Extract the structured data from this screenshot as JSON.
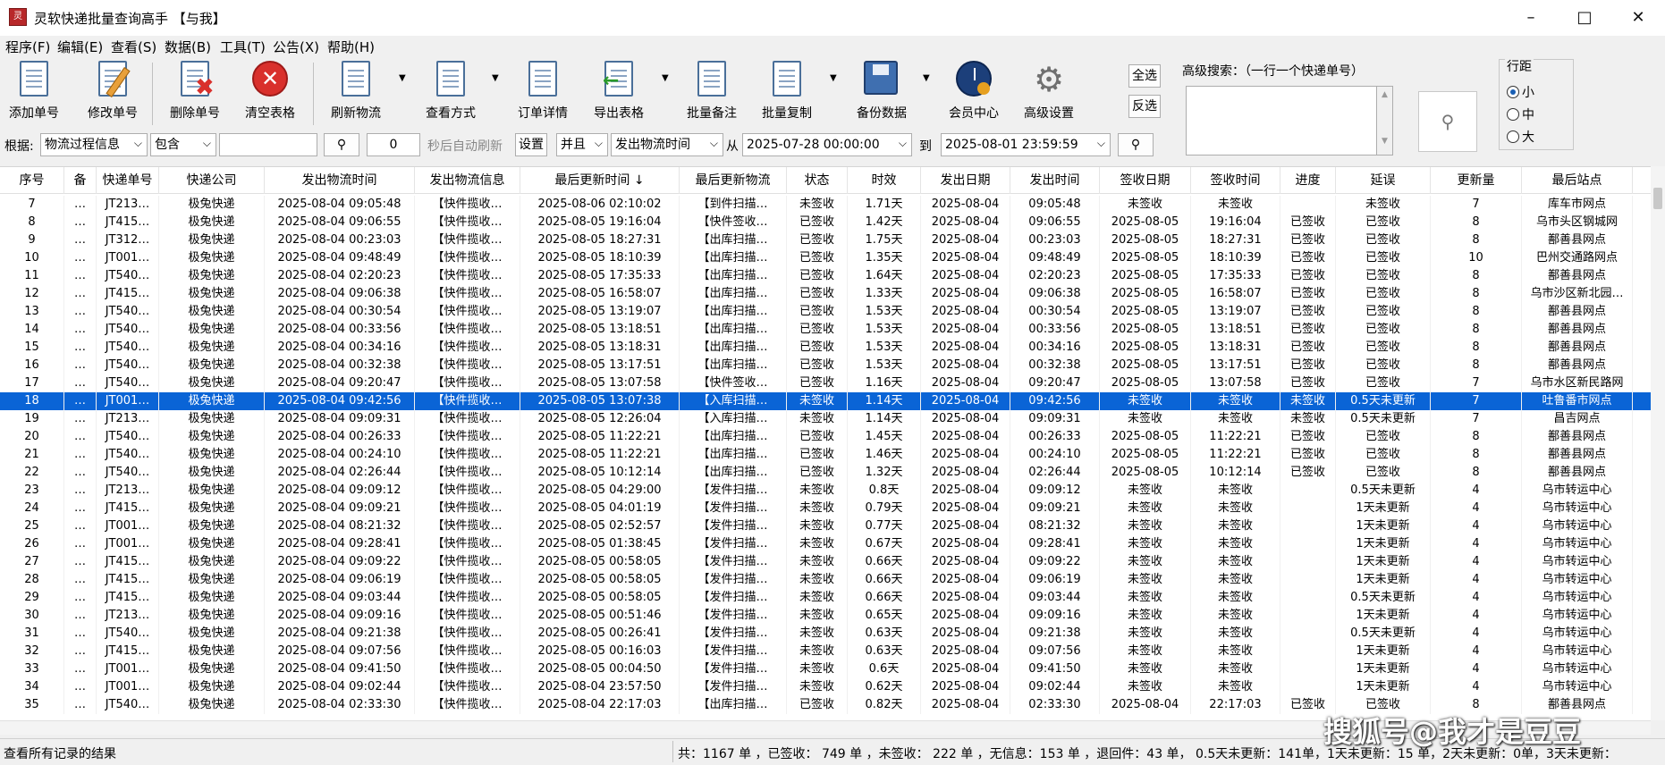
{
  "window": {
    "title": "灵软快递批量查询高手 【与我】",
    "icon_text": "灵"
  },
  "menu": [
    "程序(F)",
    "编辑(E)",
    "查看(S)",
    "数据(B)",
    "工具(T)",
    "公告(X)",
    "帮助(H)"
  ],
  "toolbar": {
    "add": "添加单号",
    "edit": "修改单号",
    "delete": "删除单号",
    "clear": "清空表格",
    "refresh": "刷新物流",
    "view": "查看方式",
    "detail": "订单详情",
    "export": "导出表格",
    "note": "批量备注",
    "copy": "批量复制",
    "backup": "备份数据",
    "member": "会员中心",
    "advanced": "高级设置",
    "select_all": "全选",
    "invert": "反选"
  },
  "advanced_search": {
    "label": "高级搜索：（一行一个快递单号）",
    "value": ""
  },
  "spacing": {
    "title": "行距",
    "options": [
      "小",
      "中",
      "大"
    ],
    "selected": "小"
  },
  "filter": {
    "by_label": "根据:",
    "field": "物流过程信息",
    "op": "包含",
    "keyword": "",
    "interval": "0",
    "interval_label": "秒后自动刷新",
    "set": "设置",
    "logic": "并且",
    "time_field": "发出物流时间",
    "from_label": "从",
    "from": "2025-07-28 00:00:00",
    "to_label": "到",
    "to": "2025-08-01 23:59:59"
  },
  "columns": [
    "序号",
    "备",
    "快递单号",
    "快递公司",
    "发出物流时间",
    "发出物流信息",
    "最后更新时间 ↓",
    "最后更新物流",
    "状态",
    "时效",
    "发出日期",
    "发出时间",
    "签收日期",
    "签收时间",
    "进度",
    "延误",
    "更新量",
    "最后站点"
  ],
  "rows": [
    [
      "7",
      "…",
      "JT213…",
      "极兔快递",
      "2025-08-04 09:05:48",
      "【快件揽收…",
      "2025-08-06 02:10:02",
      "【到件扫描…",
      "未签收",
      "1.71天",
      "2025-08-04",
      "09:05:48",
      "未签收",
      "未签收",
      "",
      "未签收",
      "7",
      "库车市网点"
    ],
    [
      "8",
      "…",
      "JT415…",
      "极兔快递",
      "2025-08-04 09:06:55",
      "【快件揽收…",
      "2025-08-05 19:16:04",
      "【快件签收…",
      "已签收",
      "1.42天",
      "2025-08-04",
      "09:06:55",
      "2025-08-05",
      "19:16:04",
      "已签收",
      "已签收",
      "8",
      "乌市头区钢城网"
    ],
    [
      "9",
      "…",
      "JT312…",
      "极兔快递",
      "2025-08-04 00:23:03",
      "【快件揽收…",
      "2025-08-05 18:27:31",
      "【出库扫描…",
      "已签收",
      "1.75天",
      "2025-08-04",
      "00:23:03",
      "2025-08-05",
      "18:27:31",
      "已签收",
      "已签收",
      "8",
      "鄯善县网点"
    ],
    [
      "10",
      "…",
      "JT001…",
      "极兔快递",
      "2025-08-04 09:48:49",
      "【快件揽收…",
      "2025-08-05 18:10:39",
      "【出库扫描…",
      "已签收",
      "1.35天",
      "2025-08-04",
      "09:48:49",
      "2025-08-05",
      "18:10:39",
      "已签收",
      "已签收",
      "10",
      "巴州交通路网点"
    ],
    [
      "11",
      "…",
      "JT540…",
      "极兔快递",
      "2025-08-04 02:20:23",
      "【快件揽收…",
      "2025-08-05 17:35:33",
      "【出库扫描…",
      "已签收",
      "1.64天",
      "2025-08-04",
      "02:20:23",
      "2025-08-05",
      "17:35:33",
      "已签收",
      "已签收",
      "8",
      "鄯善县网点"
    ],
    [
      "12",
      "…",
      "JT415…",
      "极兔快递",
      "2025-08-04 09:06:38",
      "【快件揽收…",
      "2025-08-05 16:58:07",
      "【出库扫描…",
      "已签收",
      "1.33天",
      "2025-08-04",
      "09:06:38",
      "2025-08-05",
      "16:58:07",
      "已签收",
      "已签收",
      "8",
      "乌市沙区新北园…"
    ],
    [
      "13",
      "…",
      "JT540…",
      "极兔快递",
      "2025-08-04 00:30:54",
      "【快件揽收…",
      "2025-08-05 13:19:07",
      "【出库扫描…",
      "已签收",
      "1.53天",
      "2025-08-04",
      "00:30:54",
      "2025-08-05",
      "13:19:07",
      "已签收",
      "已签收",
      "8",
      "鄯善县网点"
    ],
    [
      "14",
      "…",
      "JT540…",
      "极兔快递",
      "2025-08-04 00:33:56",
      "【快件揽收…",
      "2025-08-05 13:18:51",
      "【出库扫描…",
      "已签收",
      "1.53天",
      "2025-08-04",
      "00:33:56",
      "2025-08-05",
      "13:18:51",
      "已签收",
      "已签收",
      "8",
      "鄯善县网点"
    ],
    [
      "15",
      "…",
      "JT540…",
      "极兔快递",
      "2025-08-04 00:34:16",
      "【快件揽收…",
      "2025-08-05 13:18:31",
      "【出库扫描…",
      "已签收",
      "1.53天",
      "2025-08-04",
      "00:34:16",
      "2025-08-05",
      "13:18:31",
      "已签收",
      "已签收",
      "8",
      "鄯善县网点"
    ],
    [
      "16",
      "…",
      "JT540…",
      "极兔快递",
      "2025-08-04 00:32:38",
      "【快件揽收…",
      "2025-08-05 13:17:51",
      "【出库扫描…",
      "已签收",
      "1.53天",
      "2025-08-04",
      "00:32:38",
      "2025-08-05",
      "13:17:51",
      "已签收",
      "已签收",
      "8",
      "鄯善县网点"
    ],
    [
      "17",
      "…",
      "JT540…",
      "极兔快递",
      "2025-08-04 09:20:47",
      "【快件揽收…",
      "2025-08-05 13:07:58",
      "【快件签收…",
      "已签收",
      "1.16天",
      "2025-08-04",
      "09:20:47",
      "2025-08-05",
      "13:07:58",
      "已签收",
      "已签收",
      "7",
      "乌市水区新民路网"
    ],
    [
      "18",
      "…",
      "JT001…",
      "极兔快递",
      "2025-08-04 09:42:56",
      "【快件揽收…",
      "2025-08-05 13:07:38",
      "【入库扫描…",
      "未签收",
      "1.14天",
      "2025-08-04",
      "09:42:56",
      "未签收",
      "未签收",
      "未签收",
      "0.5天未更新",
      "7",
      "吐鲁番市网点"
    ],
    [
      "19",
      "…",
      "JT213…",
      "极兔快递",
      "2025-08-04 09:09:31",
      "【快件揽收…",
      "2025-08-05 12:26:04",
      "【入库扫描…",
      "未签收",
      "1.14天",
      "2025-08-04",
      "09:09:31",
      "未签收",
      "未签收",
      "未签收",
      "0.5天未更新",
      "7",
      "昌吉网点"
    ],
    [
      "20",
      "…",
      "JT540…",
      "极兔快递",
      "2025-08-04 00:26:33",
      "【快件揽收…",
      "2025-08-05 11:22:21",
      "【出库扫描…",
      "已签收",
      "1.45天",
      "2025-08-04",
      "00:26:33",
      "2025-08-05",
      "11:22:21",
      "已签收",
      "已签收",
      "8",
      "鄯善县网点"
    ],
    [
      "21",
      "…",
      "JT540…",
      "极兔快递",
      "2025-08-04 00:24:10",
      "【快件揽收…",
      "2025-08-05 11:22:21",
      "【出库扫描…",
      "已签收",
      "1.46天",
      "2025-08-04",
      "00:24:10",
      "2025-08-05",
      "11:22:21",
      "已签收",
      "已签收",
      "8",
      "鄯善县网点"
    ],
    [
      "22",
      "…",
      "JT540…",
      "极兔快递",
      "2025-08-04 02:26:44",
      "【快件揽收…",
      "2025-08-05 10:12:14",
      "【出库扫描…",
      "已签收",
      "1.32天",
      "2025-08-04",
      "02:26:44",
      "2025-08-05",
      "10:12:14",
      "已签收",
      "已签收",
      "8",
      "鄯善县网点"
    ],
    [
      "23",
      "…",
      "JT213…",
      "极兔快递",
      "2025-08-04 09:09:12",
      "【快件揽收…",
      "2025-08-05 04:29:00",
      "【发件扫描…",
      "未签收",
      "0.8天",
      "2025-08-04",
      "09:09:12",
      "未签收",
      "未签收",
      "",
      "0.5天未更新",
      "4",
      "乌市转运中心"
    ],
    [
      "24",
      "…",
      "JT415…",
      "极兔快递",
      "2025-08-04 09:09:21",
      "【快件揽收…",
      "2025-08-05 04:01:19",
      "【发件扫描…",
      "未签收",
      "0.79天",
      "2025-08-04",
      "09:09:21",
      "未签收",
      "未签收",
      "",
      "1天未更新",
      "4",
      "乌市转运中心"
    ],
    [
      "25",
      "…",
      "JT001…",
      "极兔快递",
      "2025-08-04 08:21:32",
      "【快件揽收…",
      "2025-08-05 02:52:57",
      "【发件扫描…",
      "未签收",
      "0.77天",
      "2025-08-04",
      "08:21:32",
      "未签收",
      "未签收",
      "",
      "1天未更新",
      "4",
      "乌市转运中心"
    ],
    [
      "26",
      "…",
      "JT001…",
      "极兔快递",
      "2025-08-04 09:28:41",
      "【快件揽收…",
      "2025-08-05 01:38:45",
      "【发件扫描…",
      "未签收",
      "0.67天",
      "2025-08-04",
      "09:28:41",
      "未签收",
      "未签收",
      "",
      "1天未更新",
      "4",
      "乌市转运中心"
    ],
    [
      "27",
      "…",
      "JT415…",
      "极兔快递",
      "2025-08-04 09:09:22",
      "【快件揽收…",
      "2025-08-05 00:58:05",
      "【发件扫描…",
      "未签收",
      "0.66天",
      "2025-08-04",
      "09:09:22",
      "未签收",
      "未签收",
      "",
      "1天未更新",
      "4",
      "乌市转运中心"
    ],
    [
      "28",
      "…",
      "JT415…",
      "极兔快递",
      "2025-08-04 09:06:19",
      "【快件揽收…",
      "2025-08-05 00:58:05",
      "【发件扫描…",
      "未签收",
      "0.66天",
      "2025-08-04",
      "09:06:19",
      "未签收",
      "未签收",
      "",
      "1天未更新",
      "4",
      "乌市转运中心"
    ],
    [
      "29",
      "…",
      "JT415…",
      "极兔快递",
      "2025-08-04 09:03:44",
      "【快件揽收…",
      "2025-08-05 00:58:05",
      "【发件扫描…",
      "未签收",
      "0.66天",
      "2025-08-04",
      "09:03:44",
      "未签收",
      "未签收",
      "",
      "0.5天未更新",
      "4",
      "乌市转运中心"
    ],
    [
      "30",
      "…",
      "JT213…",
      "极兔快递",
      "2025-08-04 09:09:16",
      "【快件揽收…",
      "2025-08-05 00:51:46",
      "【发件扫描…",
      "未签收",
      "0.65天",
      "2025-08-04",
      "09:09:16",
      "未签收",
      "未签收",
      "",
      "1天未更新",
      "4",
      "乌市转运中心"
    ],
    [
      "31",
      "…",
      "JT540…",
      "极兔快递",
      "2025-08-04 09:21:38",
      "【快件揽收…",
      "2025-08-05 00:26:41",
      "【发件扫描…",
      "未签收",
      "0.63天",
      "2025-08-04",
      "09:21:38",
      "未签收",
      "未签收",
      "",
      "0.5天未更新",
      "4",
      "乌市转运中心"
    ],
    [
      "32",
      "…",
      "JT415…",
      "极兔快递",
      "2025-08-04 09:07:56",
      "【快件揽收…",
      "2025-08-05 00:16:03",
      "【发件扫描…",
      "未签收",
      "0.63天",
      "2025-08-04",
      "09:07:56",
      "未签收",
      "未签收",
      "",
      "1天未更新",
      "4",
      "乌市转运中心"
    ],
    [
      "33",
      "…",
      "JT001…",
      "极兔快递",
      "2025-08-04 09:41:50",
      "【快件揽收…",
      "2025-08-05 00:04:50",
      "【发件扫描…",
      "未签收",
      "0.6天",
      "2025-08-04",
      "09:41:50",
      "未签收",
      "未签收",
      "",
      "1天未更新",
      "4",
      "乌市转运中心"
    ],
    [
      "34",
      "…",
      "JT001…",
      "极兔快递",
      "2025-08-04 09:02:44",
      "【快件揽收…",
      "2025-08-04 23:57:50",
      "【发件扫描…",
      "未签收",
      "0.62天",
      "2025-08-04",
      "09:02:44",
      "未签收",
      "未签收",
      "",
      "1天未更新",
      "4",
      "乌市转运中心"
    ],
    [
      "35",
      "…",
      "JT540…",
      "极兔快递",
      "2025-08-04 02:33:30",
      "【快件揽收…",
      "2025-08-04 22:17:03",
      "【出库扫描…",
      "已签收",
      "0.82天",
      "2025-08-04",
      "02:33:30",
      "2025-08-04",
      "22:17:03",
      "已签收",
      "已签收",
      "8",
      "鄯善县网点"
    ]
  ],
  "selected_row": "18",
  "status": {
    "left": "查看所有记录的结果",
    "right": "共：1167 单 ，已签收： 749 单 ，未签收： 222 单 ，无信息：153 单 ，退回件：43 单，  0.5天未更新：141单，1天未更新：15 单，2天未更新：0单，3天未更新："
  },
  "watermark": "搜狐号@我才是豆豆",
  "colors": {
    "selection": "#0a64d6",
    "delete_red": "#d9302c"
  }
}
